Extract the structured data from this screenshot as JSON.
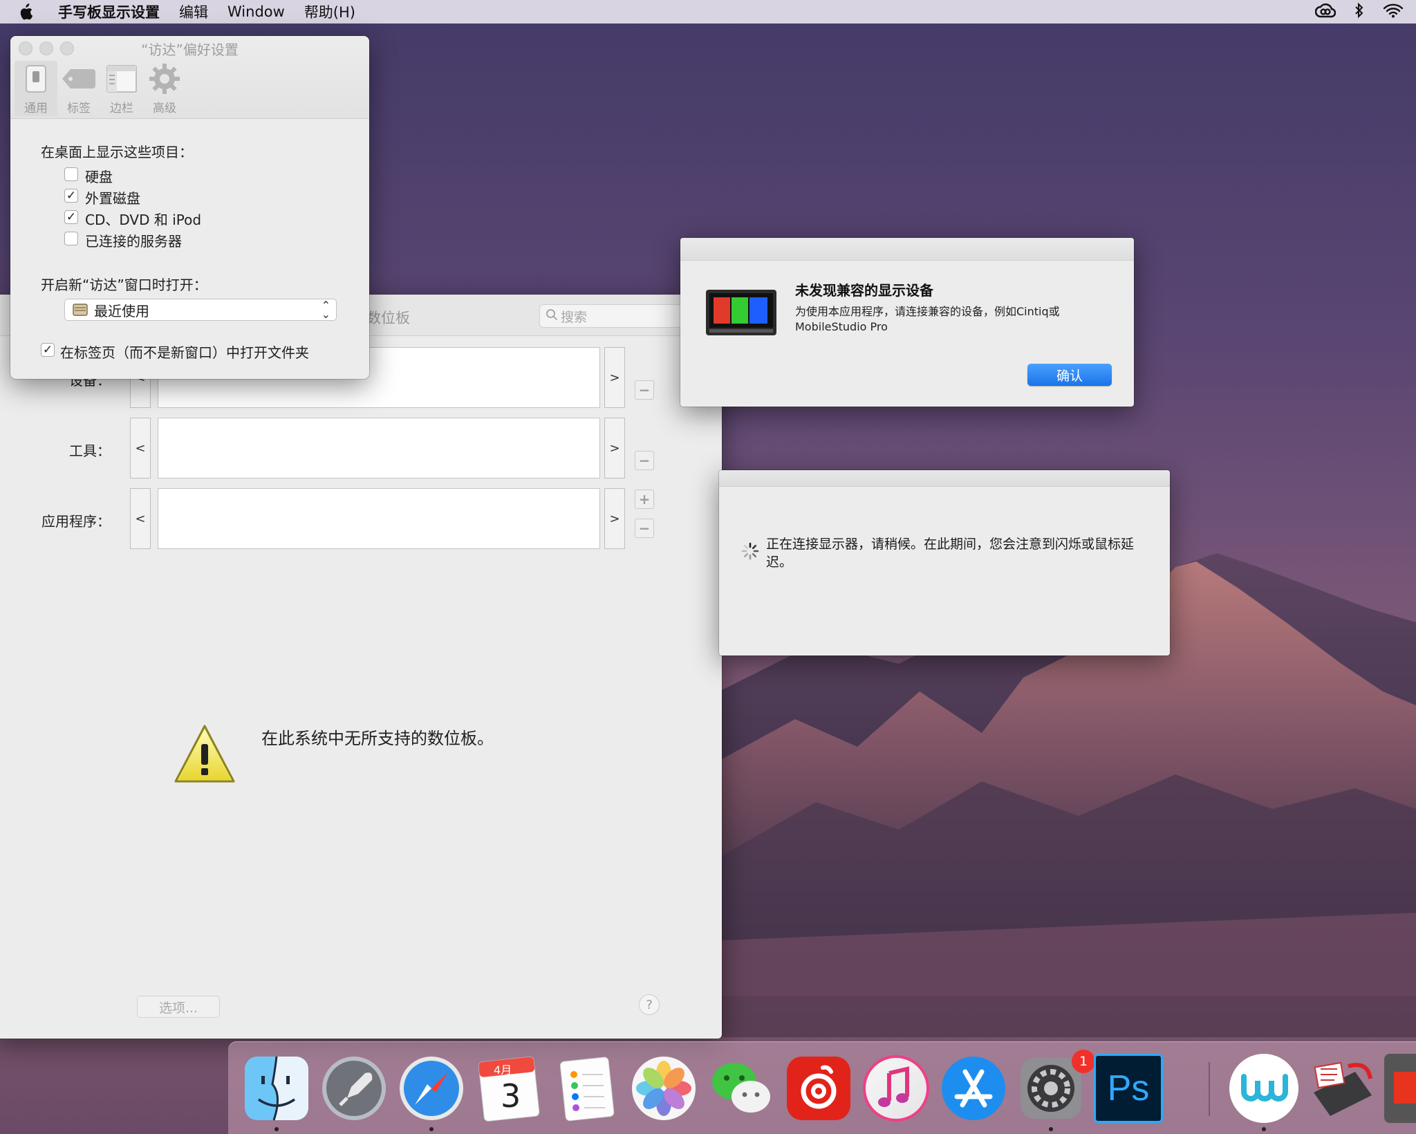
{
  "menubar": {
    "app_name": "手写板显示设置",
    "items": [
      "编辑",
      "Window",
      "帮助(H)"
    ]
  },
  "finder_prefs": {
    "title": "“访达”偏好设置",
    "toolbar": [
      {
        "label": "通用",
        "icon": "switch-icon"
      },
      {
        "label": "标签",
        "icon": "tag-icon"
      },
      {
        "label": "边栏",
        "icon": "sidebar-icon"
      },
      {
        "label": "高级",
        "icon": "gear-icon"
      }
    ],
    "desktop_heading": "在桌面上显示这些项目：",
    "desktop_items": [
      {
        "label": "硬盘",
        "checked": false
      },
      {
        "label": "外置磁盘",
        "checked": true
      },
      {
        "label": "CD、DVD 和 iPod",
        "checked": true
      },
      {
        "label": "已连接的服务器",
        "checked": false
      }
    ],
    "new_window_heading": "开启新“访达”窗口时打开：",
    "new_window_value": "最近使用",
    "open_in_tabs_label": "在标签页（而不是新窗口）中打开文件夹",
    "open_in_tabs_checked": true
  },
  "tablet_prefs": {
    "title_fragment": "数位板",
    "search_placeholder": "搜索",
    "rows": [
      {
        "label": "设备："
      },
      {
        "label": "工具："
      },
      {
        "label": "应用程序："
      }
    ],
    "nav_prev": "<",
    "nav_next": ">",
    "plus": "+",
    "minus": "−",
    "no_tablet_message": "在此系统中无所支持的数位板。",
    "options_label": "选项...",
    "help_label": "?"
  },
  "alert": {
    "title": "未发现兼容的显示设备",
    "message": "为使用本应用程序，请连接兼容的设备，例如Cintiq或MobileStudio Pro",
    "ok_label": "确认"
  },
  "connecting": {
    "message": "正在连接显示器，请稍候。在此期间，您会注意到闪烁或鼠标延迟。"
  },
  "dock": {
    "items": [
      {
        "name": "Finder",
        "icon": "finder-icon",
        "running": true
      },
      {
        "name": "Launchpad",
        "icon": "launchpad-icon",
        "running": false
      },
      {
        "name": "Safari",
        "icon": "safari-icon",
        "running": true
      },
      {
        "name": "Calendar",
        "icon": "calendar-icon",
        "running": false,
        "month": "4月",
        "day": "3"
      },
      {
        "name": "Reminders",
        "icon": "reminders-icon",
        "running": false
      },
      {
        "name": "Photos",
        "icon": "photos-icon",
        "running": false
      },
      {
        "name": "WeChat",
        "icon": "wechat-icon",
        "running": false
      },
      {
        "name": "NetEase Music",
        "icon": "netease-music-icon",
        "running": false
      },
      {
        "name": "iTunes",
        "icon": "music-icon",
        "running": false
      },
      {
        "name": "App Store",
        "icon": "app-store-icon",
        "running": false
      },
      {
        "name": "System Preferences",
        "icon": "system-preferences-icon",
        "running": true,
        "badge": "1"
      },
      {
        "name": "Photoshop",
        "icon": "photoshop-icon",
        "running": false,
        "label": "Ps"
      },
      {
        "name": "Wacom",
        "icon": "wacom-icon",
        "running": true
      },
      {
        "name": "Tablet Utility",
        "icon": "tablet-utility-icon",
        "running": false
      }
    ]
  }
}
